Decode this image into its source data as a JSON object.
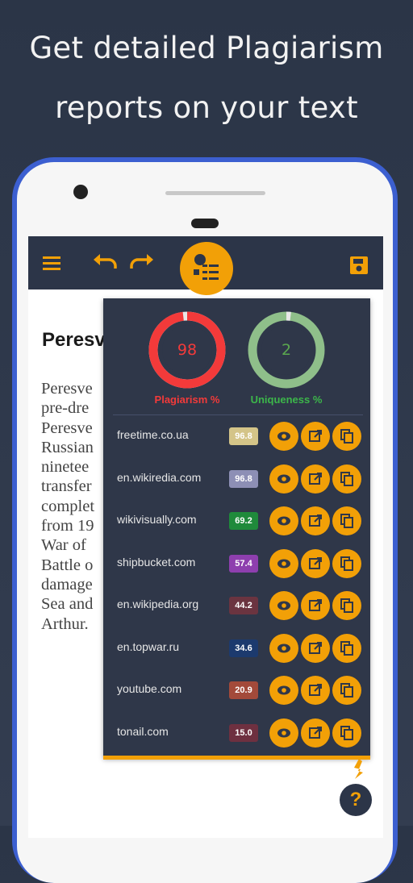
{
  "headline": {
    "line1": "Get detailed Plagiarism",
    "line2": "reports on your text"
  },
  "toolbar": {
    "menu_icon": "menu-icon",
    "undo_icon": "undo-icon",
    "redo_icon": "redo-icon",
    "report_icon": "report-icon",
    "save_icon": "save-icon"
  },
  "document": {
    "title": "Peresv",
    "lines": [
      "Peresve",
      "pre-dre",
      "Peresve",
      "Russian",
      "ninetee",
      "transfer",
      "complet",
      "from 19",
      "War of",
      "Battle o",
      "damage",
      "Sea and",
      "Arthur."
    ]
  },
  "report": {
    "plagiarism": {
      "value": "98",
      "label": "Plagiarism %",
      "percent": 98,
      "color": "#f33a3a"
    },
    "uniqueness": {
      "value": "2",
      "label": "Uniqueness %",
      "percent": 2,
      "color": "#8fbf8a"
    },
    "sources": [
      {
        "name": "freetime.co.ua",
        "percent": "96.8",
        "color": "#d4c488"
      },
      {
        "name": "en.wikiredia.com",
        "percent": "96.8",
        "color": "#8d8fb5"
      },
      {
        "name": "wikivisually.com",
        "percent": "69.2",
        "color": "#1f8a3b"
      },
      {
        "name": "shipbucket.com",
        "percent": "57.4",
        "color": "#8e3fae"
      },
      {
        "name": "en.wikipedia.org",
        "percent": "44.2",
        "color": "#6b3440"
      },
      {
        "name": "en.topwar.ru",
        "percent": "34.6",
        "color": "#1c3a6e"
      },
      {
        "name": "youtube.com",
        "percent": "20.9",
        "color": "#a34a3a"
      },
      {
        "name": "tonail.com",
        "percent": "15.0",
        "color": "#6e3040"
      }
    ],
    "action_icons": [
      "eye-icon",
      "open-external-icon",
      "copy-icon"
    ]
  },
  "help": {
    "label": "?"
  },
  "colors": {
    "accent": "#f2a007",
    "panel": "#2f3749",
    "toolbar": "#2c3548",
    "frame": "#3c5fd0"
  }
}
